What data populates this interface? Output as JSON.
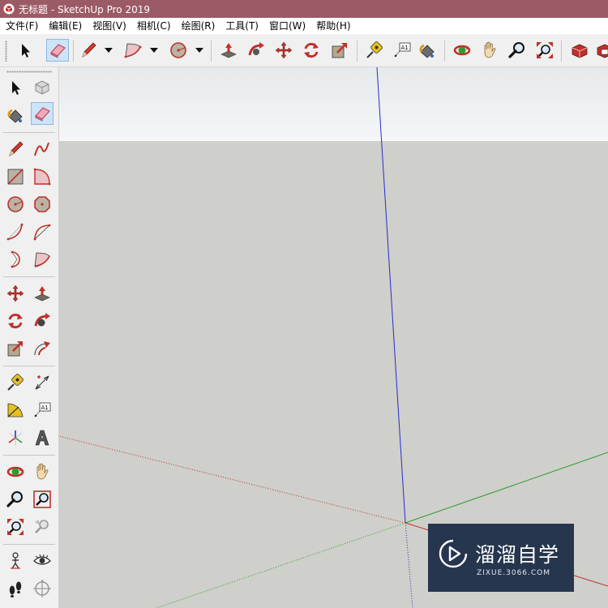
{
  "window": {
    "title": "无标题 - SketchUp Pro 2019",
    "icon": "sketchup-app-icon"
  },
  "menu": {
    "items": [
      "文件(F)",
      "编辑(E)",
      "视图(V)",
      "相机(C)",
      "绘图(R)",
      "工具(T)",
      "窗口(W)",
      "帮助(H)"
    ]
  },
  "toolbar": {
    "tools": [
      "select",
      "eraser",
      "pencil",
      "arc",
      "circle",
      "push-pull",
      "follow-me",
      "move",
      "rotate",
      "scale",
      "tape-measure",
      "text",
      "paint-bucket",
      "orbit",
      "pan",
      "zoom",
      "zoom-extents",
      "component",
      "warehouse"
    ],
    "text_label": "A1",
    "active_tool": "eraser"
  },
  "left_toolbar": {
    "text_label": "A1",
    "active_tool": "eraser"
  },
  "colors": {
    "title_bar": "#9c5a64",
    "sky": "#eef1f3",
    "ground": "#cfcfcb",
    "axis_red": "#c0302a",
    "axis_green": "#2c9c2c",
    "axis_blue": "#2a2ad0",
    "watermark_bg": "#27364f"
  },
  "watermark": {
    "text": "溜溜自学",
    "sub": "ZIXUE.3066.COM"
  }
}
